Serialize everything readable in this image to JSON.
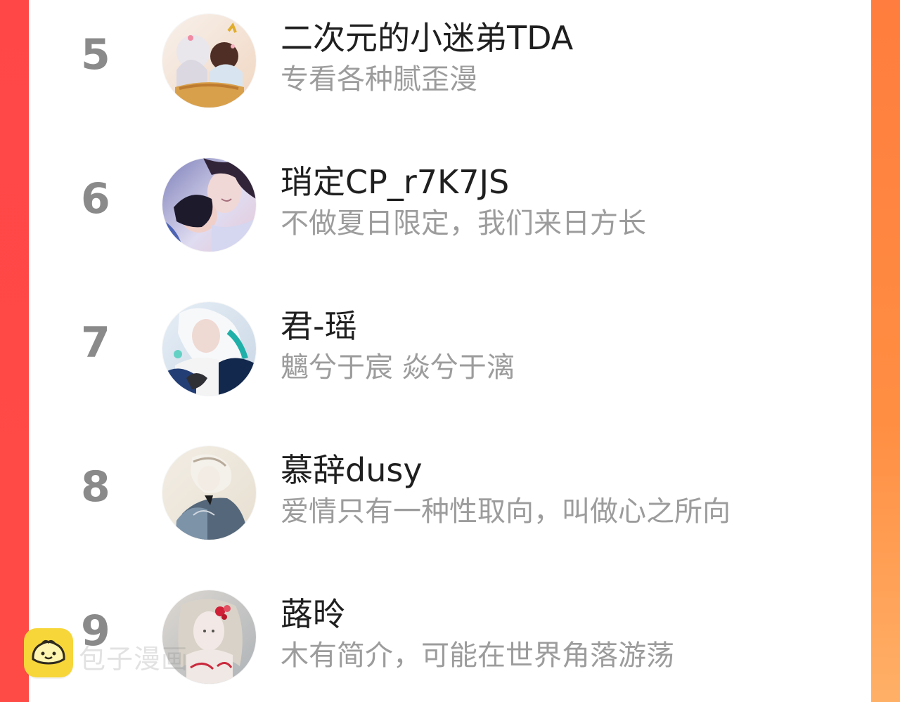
{
  "rankings": [
    {
      "rank": "5",
      "name": "二次元的小迷弟TDA",
      "description": "专看各种腻歪漫",
      "avatar_icon": "anime-avatar-icon"
    },
    {
      "rank": "6",
      "name": "琑定CP_r7K7JS",
      "description": "不做夏日限定，我们来日方长",
      "avatar_icon": "portrait-avatar-icon"
    },
    {
      "rank": "7",
      "name": "君-瑶",
      "description": "魑兮于宸 焱兮于漓",
      "avatar_icon": "white-hair-avatar-icon"
    },
    {
      "rank": "8",
      "name": "慕辞dusy",
      "description": "爱情只有一种性取向，叫做心之所向",
      "avatar_icon": "sketch-avatar-icon"
    },
    {
      "rank": "9",
      "name": "蕗昤",
      "description": "木有简介，可能在世界角落游荡",
      "avatar_icon": "flower-hair-avatar-icon"
    }
  ],
  "watermark": {
    "text": "包子漫画",
    "icon": "bun-icon"
  },
  "colors": {
    "left_bg": "#ff4a47",
    "right_bg": "#ff8a3f",
    "panel_bg": "#ffffff",
    "rank_text": "#8a8a8a",
    "name_text": "#1f1f1f",
    "desc_text": "#9c9c9c",
    "watermark_badge": "#f7d63a"
  }
}
